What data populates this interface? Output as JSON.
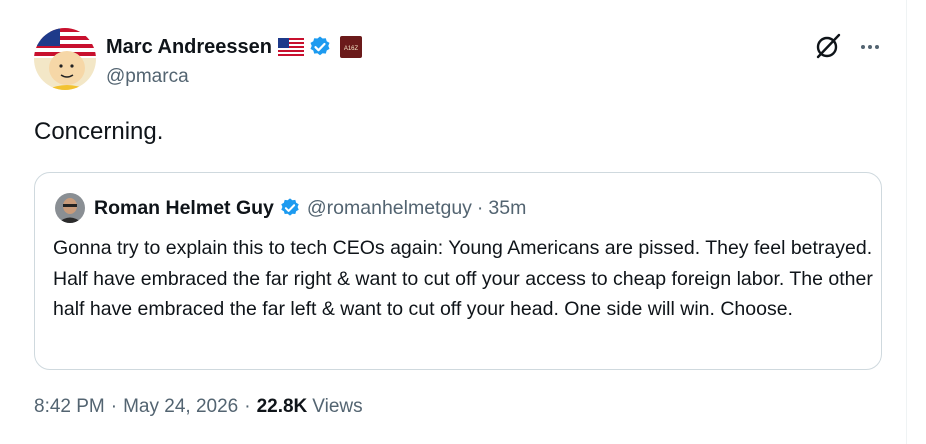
{
  "author": {
    "display_name": "Marc Andreessen",
    "handle": "@pmarca",
    "affiliation_badge": "A16Z",
    "icons": [
      "us-flag-icon",
      "verified-badge-icon",
      "affiliation-badge-icon"
    ]
  },
  "header_actions": [
    "grok-icon",
    "more-options-icon"
  ],
  "tweet": {
    "text": "Concerning."
  },
  "quoted_tweet": {
    "display_name": "Roman Helmet Guy",
    "handle": "@romanhelmetguy",
    "separator": "·",
    "time_ago": "35m",
    "body": "Gonna try to explain this to tech CEOs again: Young Americans are pissed. They feel betrayed. Half have embraced the far right & want to cut off your access to cheap foreign labor. The other half have embraced the far left & want to cut off your head. One side will win. Choose."
  },
  "meta": {
    "time": "8:42 PM",
    "separator": "·",
    "date": "May 24, 2026",
    "views_count": "22.8K",
    "views_label": "Views"
  },
  "colors": {
    "text_primary": "#0f1419",
    "text_secondary": "#536471",
    "verified_blue": "#1d9bf0",
    "border": "#cfd9de"
  }
}
